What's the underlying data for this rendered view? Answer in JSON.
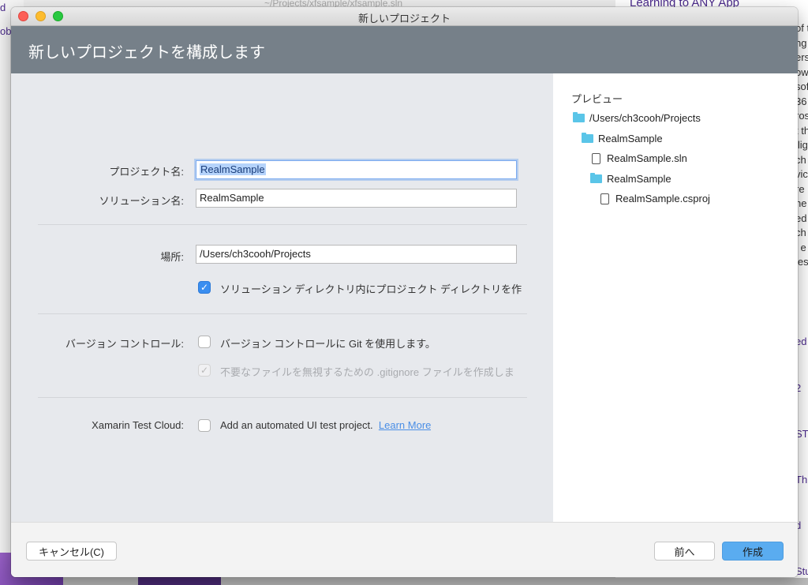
{
  "background": {
    "top_window_title": "~/Projects/xfsample/xfsample.sln",
    "left_fragments": [
      "d",
      "ob"
    ],
    "right_heading": "Learning to ANY App",
    "right_text_fragments": [
      "of t",
      "ng",
      "ers",
      "ow",
      "sof",
      "36",
      "ros",
      "t th",
      "llig",
      "ch",
      "vic",
      "re",
      "he",
      "ed",
      "ch",
      "l e",
      "les"
    ],
    "right_link_fragments": [
      "ed",
      "2",
      "ST",
      "Th",
      "d",
      "Stu"
    ]
  },
  "dialog": {
    "window_title": "新しいプロジェクト",
    "header_title": "新しいプロジェクトを構成します",
    "form": {
      "project_name": {
        "label": "プロジェクト名:",
        "value": "RealmSample"
      },
      "solution_name": {
        "label": "ソリューション名:",
        "value": "RealmSample"
      },
      "location": {
        "label": "場所:",
        "value": "/Users/ch3cooh/Projects"
      },
      "create_project_dir": {
        "label": "ソリューション ディレクトリ内にプロジェクト ディレクトリを作",
        "checked": true
      },
      "version_control": {
        "label": "バージョン コントロール:",
        "use_git": {
          "label": "バージョン コントロールに Git を使用します。",
          "checked": false
        },
        "gitignore": {
          "label": "不要なファイルを無視するための .gitignore ファイルを作成しま",
          "checked": true,
          "disabled": true
        }
      },
      "test_cloud": {
        "label": "Xamarin Test Cloud:",
        "option": {
          "label": "Add an automated UI test project.",
          "checked": false
        },
        "learn_more": "Learn More"
      }
    },
    "preview": {
      "heading": "プレビュー",
      "tree": [
        {
          "type": "folder",
          "name": "/Users/ch3cooh/Projects",
          "depth": 0
        },
        {
          "type": "folder",
          "name": "RealmSample",
          "depth": 1
        },
        {
          "type": "file",
          "name": "RealmSample.sln",
          "depth": 2
        },
        {
          "type": "folder",
          "name": "RealmSample",
          "depth": 2
        },
        {
          "type": "file",
          "name": "RealmSample.csproj",
          "depth": 3
        }
      ]
    },
    "footer": {
      "cancel_label": "キャンセル(C)",
      "back_label": "前へ",
      "create_label": "作成"
    }
  },
  "colors": {
    "header": "#768089",
    "accent": "#3a8ef0",
    "primary_button": "#5aacf0",
    "folder": "#5ac5e8",
    "link": "#4a8ee6"
  }
}
